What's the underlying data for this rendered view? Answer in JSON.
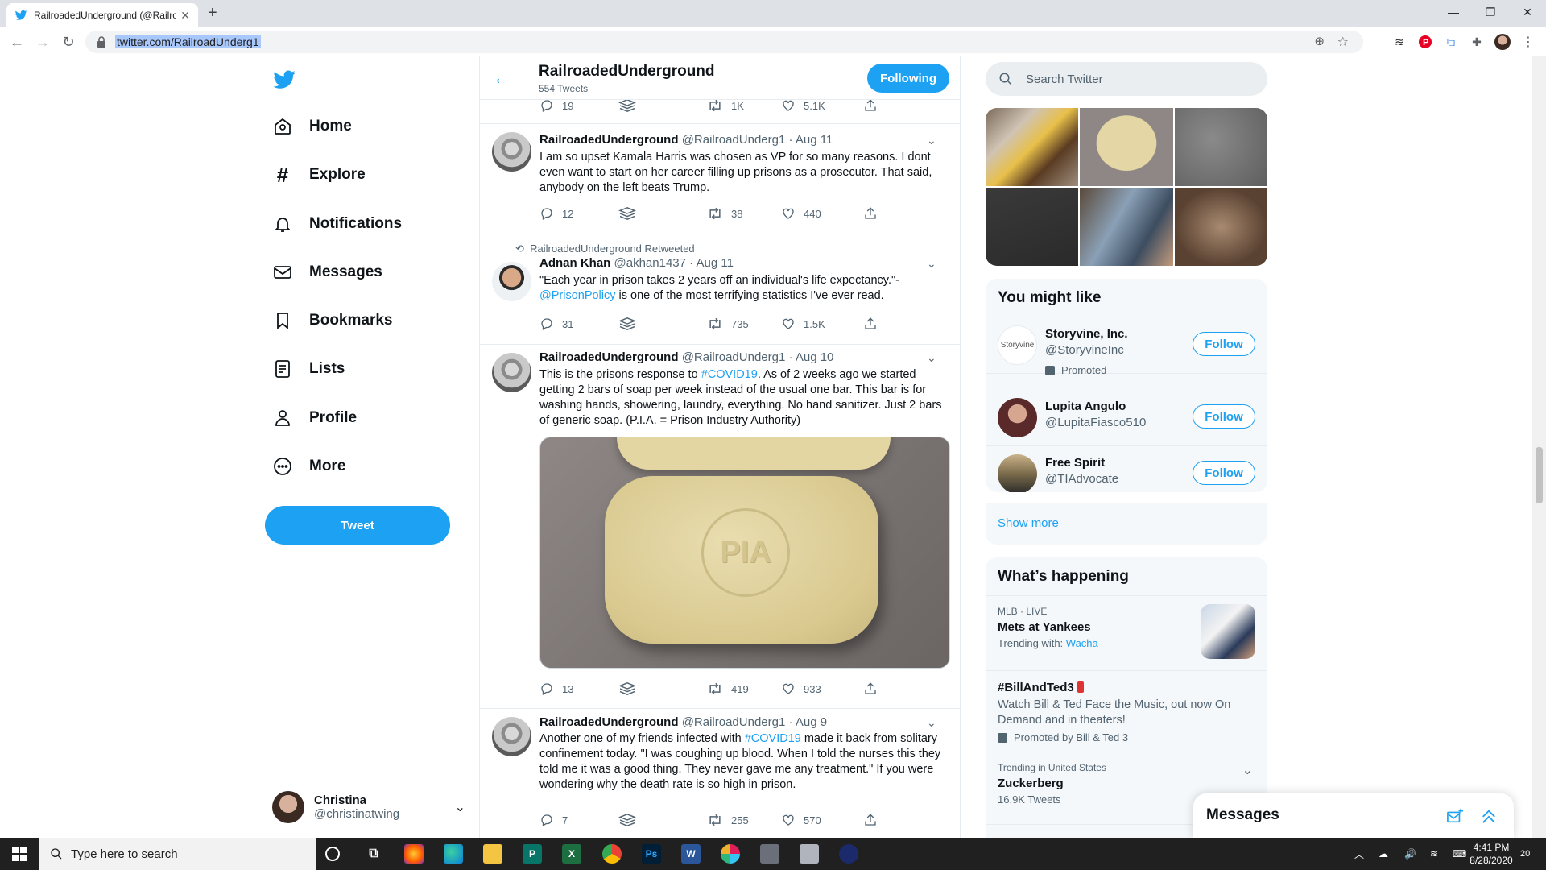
{
  "browser": {
    "tab_title": "RailroadedUnderground (@Railro",
    "url": "twitter.com/RailroadUnderg1"
  },
  "nav": {
    "items": [
      {
        "label": "Home",
        "icon": "home-icon"
      },
      {
        "label": "Explore",
        "icon": "hashtag-icon"
      },
      {
        "label": "Notifications",
        "icon": "bell-icon"
      },
      {
        "label": "Messages",
        "icon": "envelope-icon"
      },
      {
        "label": "Bookmarks",
        "icon": "bookmark-icon"
      },
      {
        "label": "Lists",
        "icon": "list-icon"
      },
      {
        "label": "Profile",
        "icon": "person-icon"
      },
      {
        "label": "More",
        "icon": "more-icon"
      }
    ],
    "tweet_button": "Tweet",
    "account": {
      "name": "Christina",
      "handle": "@christinatwing"
    }
  },
  "profile_header": {
    "name": "RailroadedUnderground",
    "tweet_count": "554 Tweets",
    "following_label": "Following"
  },
  "timeline": {
    "top_stats": {
      "replies": "19",
      "retweets": "1K",
      "likes": "5.1K"
    },
    "tweets": [
      {
        "name": "RailroadedUnderground",
        "handle": "@RailroadUnderg1",
        "date": "Aug 11",
        "text": "I am so upset Kamala Harris was chosen as VP for so many reasons. I dont even want to start on her career filling up prisons as a prosecutor. That said, anybody on the left beats Trump.",
        "replies": "12",
        "retweets": "38",
        "likes": "440"
      },
      {
        "retweeted_by": "RailroadedUnderground Retweeted",
        "name": "Adnan Khan",
        "handle": "@akhan1437",
        "date": "Aug 11",
        "text_a": "\"Each year in prison takes 2 years off an individual's life expectancy.\"-",
        "mention": "@PrisonPolicy",
        "text_b": " is one of the most terrifying statistics I've ever read.",
        "replies": "31",
        "retweets": "735",
        "likes": "1.5K"
      },
      {
        "name": "RailroadedUnderground",
        "handle": "@RailroadUnderg1",
        "date": "Aug 10",
        "text_a": "This is the prisons response to ",
        "hashtag": "#COVID19",
        "text_b": ". As of 2 weeks ago we started getting 2 bars of soap per week instead of the usual one bar. This bar is for washing hands, showering, laundry, everything. No hand sanitizer. Just 2 bars of generic soap. (P.I.A. = Prison Industry Authority)",
        "image_stamp": "PIA",
        "replies": "13",
        "retweets": "419",
        "likes": "933"
      },
      {
        "name": "RailroadedUnderground",
        "handle": "@RailroadUnderg1",
        "date": "Aug 9",
        "text_a": "Another one of my friends infected with ",
        "hashtag": "#COVID19",
        "text_b": " made it back from solitary confinement today. \"I was coughing up blood. When I told the nurses this they told me it was a good thing. They never gave me any treatment.\" If you were wondering why the death rate is so high in prison.",
        "replies": "7",
        "retweets": "255",
        "likes": "570"
      }
    ]
  },
  "sidebar": {
    "search_placeholder": "Search Twitter",
    "you_might_like": {
      "title": "You might like",
      "accounts": [
        {
          "name": "Storyvine, Inc.",
          "handle": "@StoryvineInc",
          "promoted": "Promoted",
          "button": "Follow",
          "avatar_text": "Storyvine"
        },
        {
          "name": "Lupita Angulo",
          "handle": "@LupitaFiasco510",
          "button": "Follow"
        },
        {
          "name": "Free Spirit",
          "handle": "@TIAdvocate",
          "button": "Follow"
        }
      ],
      "show_more": "Show more"
    },
    "whats_happening": {
      "title": "What’s happening",
      "trends": [
        {
          "meta": "MLB · LIVE",
          "title": "Mets at Yankees",
          "sub_prefix": "Trending with: ",
          "sub_link": "Wacha"
        },
        {
          "title": "#BillAndTed3",
          "desc": "Watch Bill & Ted Face the Music, out now On Demand and in theaters!",
          "promoted": "Promoted by Bill & Ted 3"
        },
        {
          "meta": "Trending in United States",
          "title": "Zuckerberg",
          "sub": "16.9K Tweets"
        }
      ]
    },
    "messages_drawer": "Messages"
  },
  "taskbar": {
    "search_placeholder": "Type here to search",
    "time": "4:41 PM",
    "date": "8/28/2020",
    "notifications": "20"
  },
  "colors": {
    "twitter_blue": "#1da1f2",
    "text_secondary": "#536471"
  }
}
